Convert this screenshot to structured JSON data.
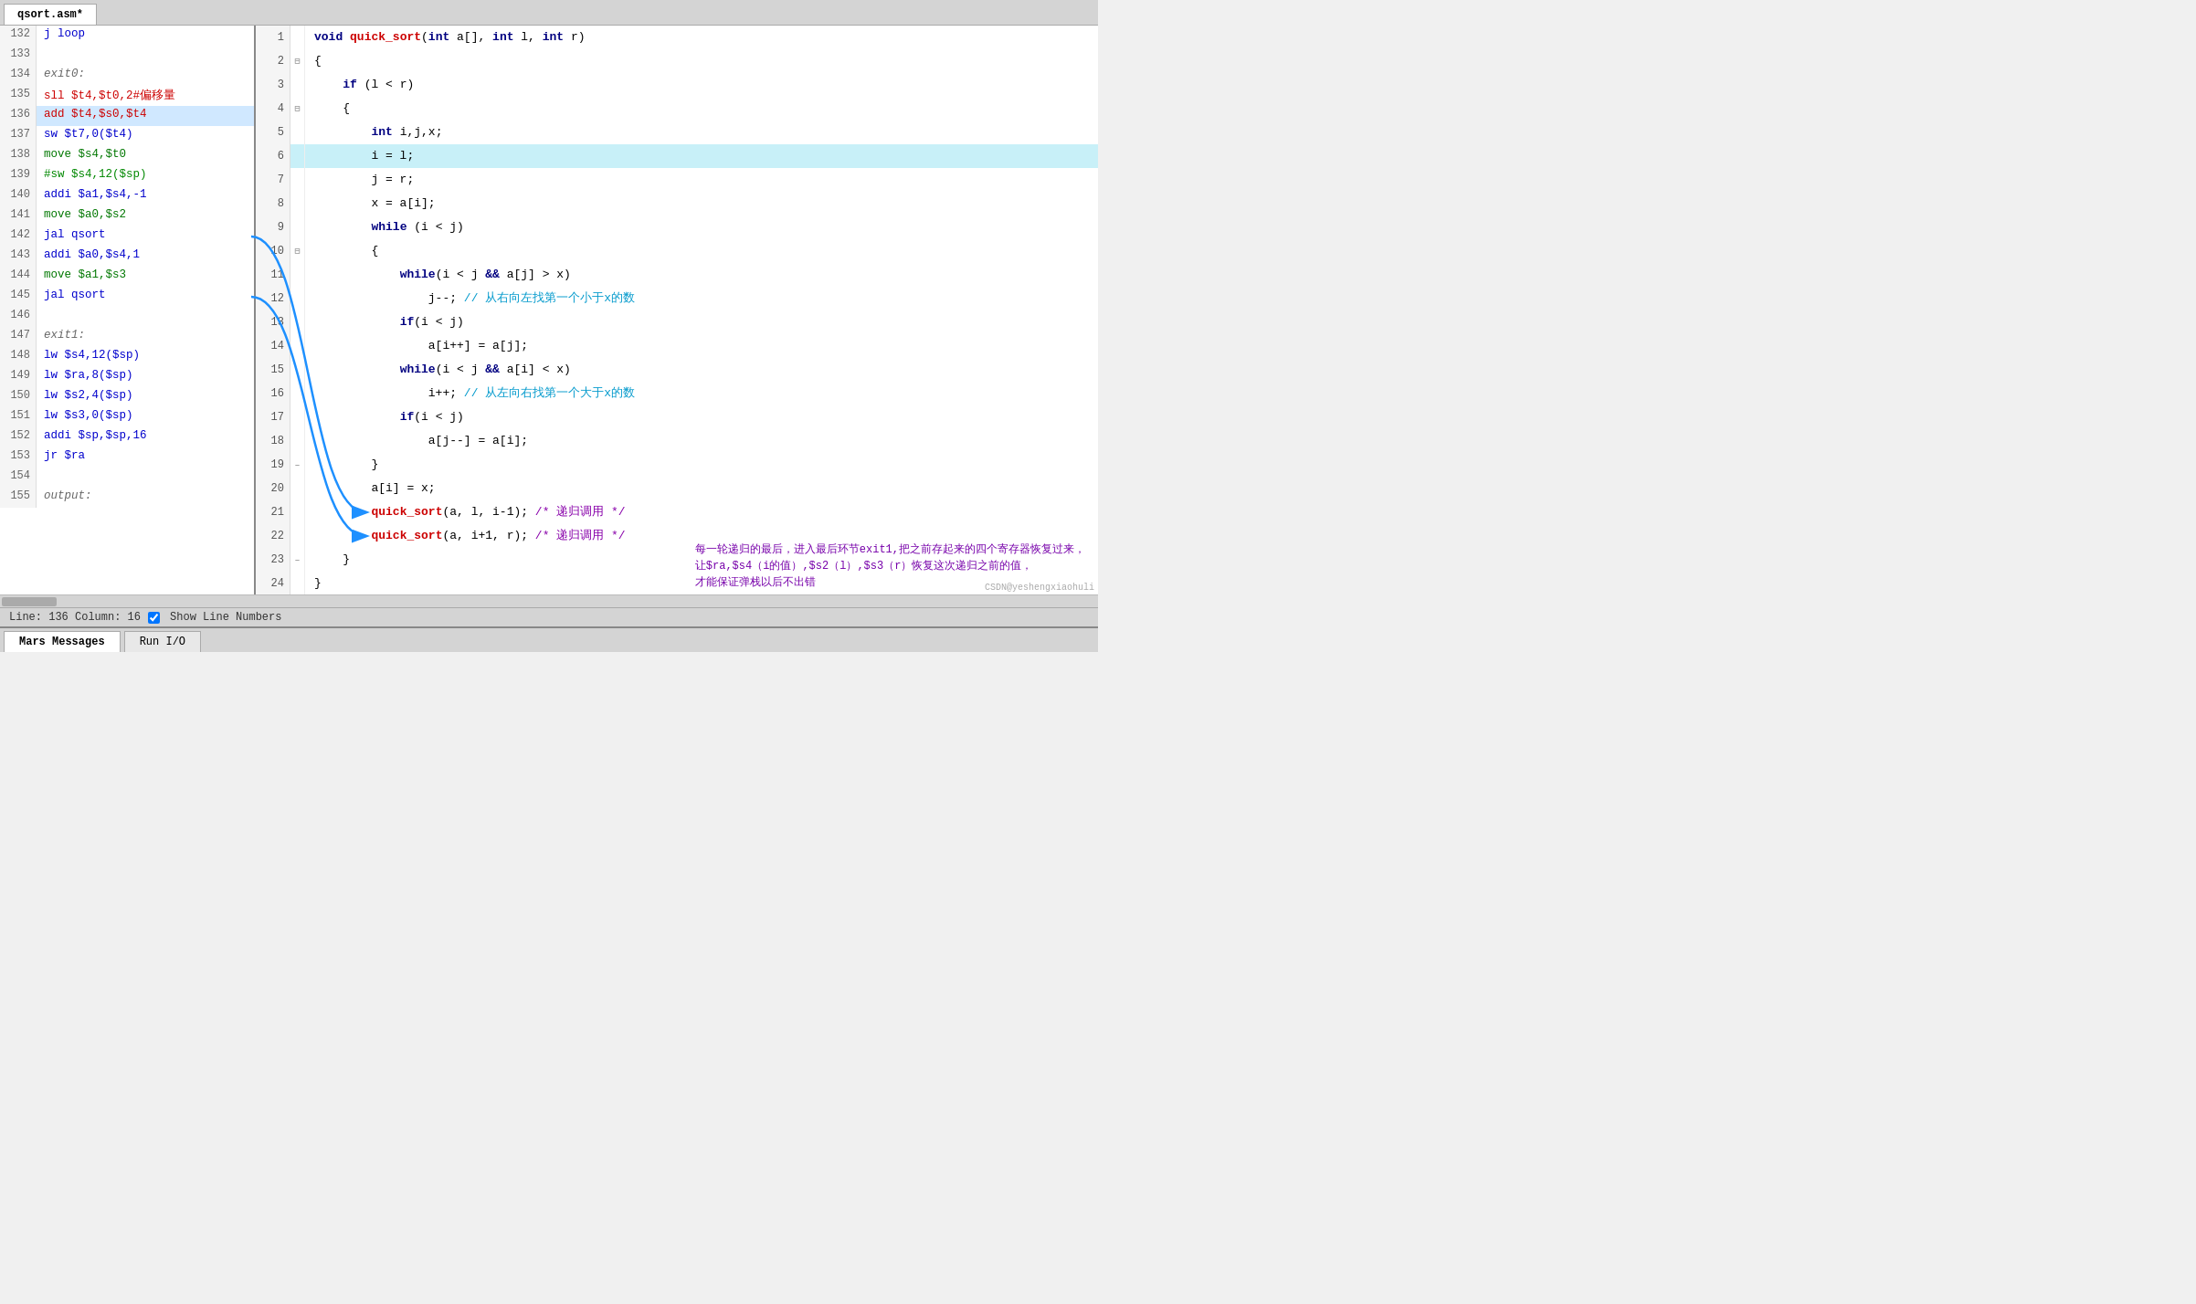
{
  "tabs": [
    {
      "label": "qsort.asm*",
      "active": true
    }
  ],
  "left_pane": {
    "lines": [
      {
        "num": "132",
        "content": "j loop",
        "cls": "asm-blue",
        "highlight": false
      },
      {
        "num": "133",
        "content": "",
        "cls": "",
        "highlight": false
      },
      {
        "num": "134",
        "content": "exit0:",
        "cls": "asm-label",
        "highlight": false
      },
      {
        "num": "135",
        "content": "sll $t4,$t0,2#偏移量",
        "cls": "asm-red",
        "highlight": false
      },
      {
        "num": "136",
        "content": "add $t4,$s0,$t4",
        "cls": "asm-red",
        "highlight": true
      },
      {
        "num": "137",
        "content": "sw $t7,0($t4)",
        "cls": "asm-blue",
        "highlight": false
      },
      {
        "num": "138",
        "content": "move $s4,$t0",
        "cls": "asm-green",
        "highlight": false
      },
      {
        "num": "139",
        "content": "#sw $s4,12($sp)",
        "cls": "asm-comment",
        "highlight": false
      },
      {
        "num": "140",
        "content": "addi $a1,$s4,-1",
        "cls": "asm-blue",
        "highlight": false
      },
      {
        "num": "141",
        "content": "move $a0,$s2",
        "cls": "asm-green",
        "highlight": false
      },
      {
        "num": "142",
        "content": "jal qsort",
        "cls": "asm-blue",
        "highlight": false
      },
      {
        "num": "143",
        "content": "addi $a0,$s4,1",
        "cls": "asm-blue",
        "highlight": false
      },
      {
        "num": "144",
        "content": "move $a1,$s3",
        "cls": "asm-green",
        "highlight": false
      },
      {
        "num": "145",
        "content": "jal qsort",
        "cls": "asm-blue",
        "highlight": false
      },
      {
        "num": "146",
        "content": "",
        "cls": "",
        "highlight": false
      },
      {
        "num": "147",
        "content": "exit1:",
        "cls": "asm-label",
        "highlight": false
      },
      {
        "num": "148",
        "content": "lw $s4,12($sp)",
        "cls": "asm-blue",
        "highlight": false
      },
      {
        "num": "149",
        "content": "lw $ra,8($sp)",
        "cls": "asm-blue",
        "highlight": false
      },
      {
        "num": "150",
        "content": "lw $s2,4($sp)",
        "cls": "asm-blue",
        "highlight": false
      },
      {
        "num": "151",
        "content": "lw $s3,0($sp)",
        "cls": "asm-blue",
        "highlight": false
      },
      {
        "num": "152",
        "content": "addi $sp,$sp,16",
        "cls": "asm-blue",
        "highlight": false
      },
      {
        "num": "153",
        "content": "jr $ra",
        "cls": "asm-blue",
        "highlight": false
      },
      {
        "num": "154",
        "content": "",
        "cls": "",
        "highlight": false
      },
      {
        "num": "155",
        "content": "output:",
        "cls": "asm-label",
        "highlight": false
      }
    ]
  },
  "right_pane": {
    "lines": [
      {
        "num": "1",
        "fold": "",
        "html_key": "line1"
      },
      {
        "num": "2",
        "fold": "⊟",
        "html_key": "line2"
      },
      {
        "num": "3",
        "fold": "",
        "html_key": "line3"
      },
      {
        "num": "4",
        "fold": "⊟",
        "html_key": "line4"
      },
      {
        "num": "5",
        "fold": "",
        "html_key": "line5"
      },
      {
        "num": "6",
        "fold": "",
        "html_key": "line6",
        "highlight": true
      },
      {
        "num": "7",
        "fold": "",
        "html_key": "line7"
      },
      {
        "num": "8",
        "fold": "",
        "html_key": "line8"
      },
      {
        "num": "9",
        "fold": "",
        "html_key": "line9"
      },
      {
        "num": "10",
        "fold": "⊟",
        "html_key": "line10"
      },
      {
        "num": "11",
        "fold": "",
        "html_key": "line11"
      },
      {
        "num": "12",
        "fold": "",
        "html_key": "line12"
      },
      {
        "num": "13",
        "fold": "",
        "html_key": "line13"
      },
      {
        "num": "14",
        "fold": "",
        "html_key": "line14"
      },
      {
        "num": "15",
        "fold": "",
        "html_key": "line15"
      },
      {
        "num": "16",
        "fold": "",
        "html_key": "line16"
      },
      {
        "num": "17",
        "fold": "",
        "html_key": "line17"
      },
      {
        "num": "18",
        "fold": "",
        "html_key": "line18"
      },
      {
        "num": "19",
        "fold": "–",
        "html_key": "line19"
      },
      {
        "num": "20",
        "fold": "",
        "html_key": "line20"
      },
      {
        "num": "21",
        "fold": "",
        "html_key": "line21"
      },
      {
        "num": "22",
        "fold": "",
        "html_key": "line22"
      },
      {
        "num": "23",
        "fold": "–",
        "html_key": "line23"
      },
      {
        "num": "24",
        "fold": "",
        "html_key": "line24"
      }
    ]
  },
  "status_bar": {
    "line": "136",
    "column": "16",
    "show_line_numbers_label": "Show Line Numbers",
    "text": "Line: 136 Column: 16"
  },
  "bottom_tabs": [
    {
      "label": "Mars Messages",
      "active": true
    },
    {
      "label": "Run I/O",
      "active": false
    }
  ],
  "annotation": {
    "text1": "每一轮递归的最后，进入最后环节exit1,把之前存起来的四个寄存器恢复过来，",
    "text2": "让$ra,$s4（i的值）,$s2（l）,$s3（r）恢复这次递归之前的值，",
    "text3": "才能保证弹栈以后不出错"
  },
  "watermark": "CSDN@yeshengxiaohuli"
}
